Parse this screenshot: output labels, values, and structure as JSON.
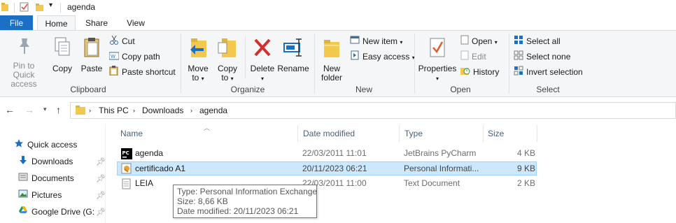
{
  "window": {
    "title": "agenda"
  },
  "tabs": {
    "file": "File",
    "home": "Home",
    "share": "Share",
    "view": "View"
  },
  "ribbon": {
    "clipboard": {
      "label": "Clipboard",
      "pin_line1": "Pin to Quick",
      "pin_line2": "access",
      "copy": "Copy",
      "paste": "Paste",
      "cut": "Cut",
      "copy_path": "Copy path",
      "paste_shortcut": "Paste shortcut"
    },
    "organize": {
      "label": "Organize",
      "move_line1": "Move",
      "move_line2": "to",
      "copy_line1": "Copy",
      "copy_line2": "to",
      "delete": "Delete",
      "rename": "Rename"
    },
    "new": {
      "label": "New",
      "new_folder_line1": "New",
      "new_folder_line2": "folder",
      "new_item": "New item",
      "easy_access": "Easy access"
    },
    "open": {
      "label": "Open",
      "properties": "Properties",
      "open": "Open",
      "edit": "Edit",
      "history": "History"
    },
    "select": {
      "label": "Select",
      "select_all": "Select all",
      "select_none": "Select none",
      "invert": "Invert selection"
    }
  },
  "address": {
    "crumbs": [
      "This PC",
      "Downloads",
      "agenda"
    ]
  },
  "navpane": {
    "items": [
      {
        "label": "Quick access",
        "icon": "star-icon"
      },
      {
        "label": "Downloads",
        "icon": "download-arrow-icon"
      },
      {
        "label": "Documents",
        "icon": "documents-icon"
      },
      {
        "label": "Pictures",
        "icon": "pictures-icon"
      },
      {
        "label": "Google Drive (G:",
        "icon": "google-drive-icon"
      }
    ]
  },
  "filelist": {
    "columns": {
      "name": "Name",
      "date": "Date modified",
      "type": "Type",
      "size": "Size"
    },
    "rows": [
      {
        "name": "agenda",
        "date": "22/03/2011 11:01",
        "type": "JetBrains PyCharm",
        "size": "4 KB",
        "icon": "pycharm-icon"
      },
      {
        "name": "certificado A1",
        "date": "20/11/2023 06:21",
        "type": "Personal Informati...",
        "size": "9 KB",
        "icon": "certificate-icon"
      },
      {
        "name": "LEIA",
        "date": "22/03/2011 11:00",
        "type": "Text Document",
        "size": "2 KB",
        "icon": "text-file-icon"
      }
    ]
  },
  "tooltip": {
    "type": "Type: Personal Information Exchange",
    "size": "Size: 8,66 KB",
    "date": "Date modified: 20/11/2023 06:21"
  },
  "colors": {
    "accent": "#1a6fc7",
    "selection": "#cce8ff",
    "folder": "#f2c94c",
    "delete_red": "#d32f2f"
  }
}
